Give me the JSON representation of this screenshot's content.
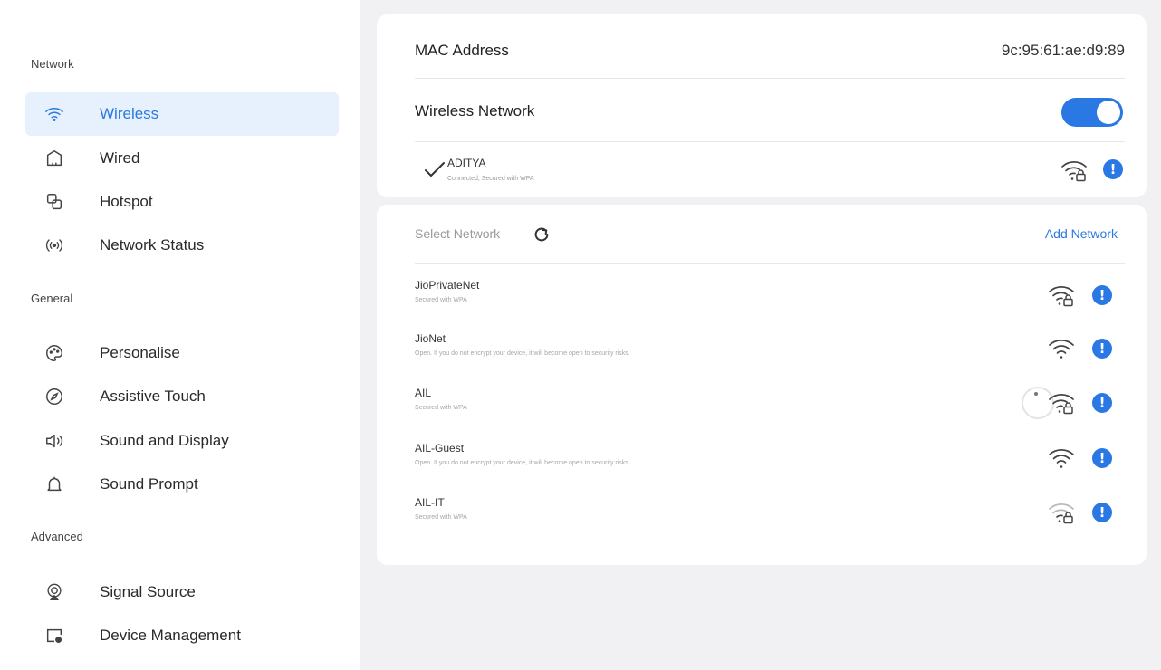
{
  "sidebar": {
    "sections": [
      {
        "title": "Network",
        "items": [
          {
            "label": "Wireless",
            "icon": "wifi-icon",
            "active": true
          },
          {
            "label": "Wired",
            "icon": "home-icon"
          },
          {
            "label": "Hotspot",
            "icon": "hotspot-icon"
          },
          {
            "label": "Network Status",
            "icon": "broadcast-icon"
          }
        ]
      },
      {
        "title": "General",
        "items": [
          {
            "label": "Personalise",
            "icon": "palette-icon"
          },
          {
            "label": "Assistive Touch",
            "icon": "compass-icon"
          },
          {
            "label": "Sound and Display",
            "icon": "speaker-icon"
          },
          {
            "label": "Sound Prompt",
            "icon": "bell-icon"
          }
        ]
      },
      {
        "title": "Advanced",
        "items": [
          {
            "label": "Signal Source",
            "icon": "signal-source-icon"
          },
          {
            "label": "Device Management",
            "icon": "device-management-icon"
          }
        ]
      }
    ]
  },
  "status": {
    "mac_label": "MAC Address",
    "mac_value": "9c:95:61:ae:d9:89",
    "wireless_label": "Wireless Network",
    "wireless_enabled": true,
    "connected": {
      "name": "ADITYA",
      "subtitle": "Connected, Secured with WPA"
    }
  },
  "networks": {
    "select_label": "Select Network",
    "add_label": "Add Network",
    "list": [
      {
        "name": "JioPrivateNet",
        "subtitle": "Secured with WPA",
        "secured": true
      },
      {
        "name": "JioNet",
        "subtitle": "Open. If you do not encrypt your device, it will become open to security risks.",
        "secured": false
      },
      {
        "name": "AIL",
        "subtitle": "Secured with WPA",
        "secured": true,
        "connecting": true
      },
      {
        "name": "AIL-Guest",
        "subtitle": "Open. If you do not encrypt your device, it will become open to security risks.",
        "secured": false
      },
      {
        "name": "AIL-IT",
        "subtitle": "Secured with WPA",
        "secured": true
      }
    ]
  },
  "colors": {
    "accent": "#2a78e4",
    "active_bg": "#e7f0fd"
  }
}
